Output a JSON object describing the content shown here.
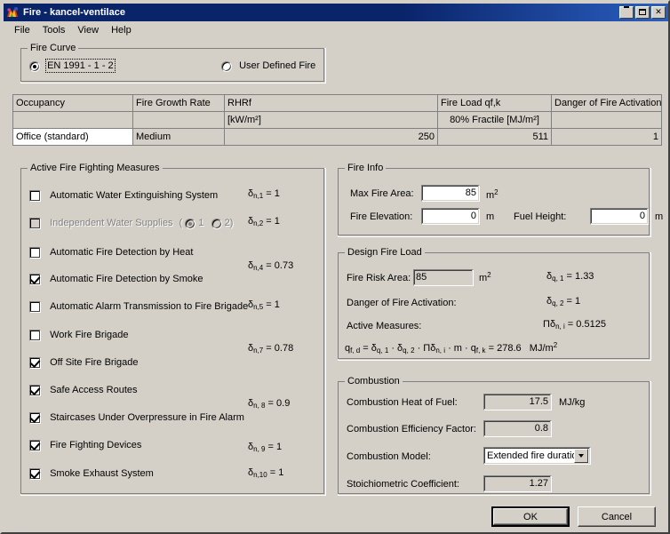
{
  "window": {
    "title": "Fire - kancel-ventilace",
    "icon": "flame-icon",
    "minimize": "–",
    "maximize": "□",
    "close": "✕"
  },
  "menu": [
    {
      "label": "File"
    },
    {
      "label": "Tools"
    },
    {
      "label": "View"
    },
    {
      "label": "Help"
    }
  ],
  "fire_curve": {
    "title": "Fire Curve",
    "options": [
      {
        "label": "EN 1991 - 1 - 2",
        "selected": true
      },
      {
        "label": "User Defined Fire",
        "selected": false
      }
    ]
  },
  "table": {
    "headers": [
      "Occupancy",
      "Fire Growth Rate",
      "RHRf",
      "Fire Load qf,k",
      "Danger of Fire Activation"
    ],
    "units": [
      "",
      "",
      "[kW/m²]",
      "80% Fractile [MJ/m²]",
      ""
    ],
    "row": [
      "Office (standard)",
      "Medium",
      "250",
      "511",
      "1"
    ]
  },
  "measures": {
    "title": "Active Fire Fighting Measures",
    "items": [
      {
        "label": "Automatic Water Extinguishing System",
        "checked": false,
        "disabled": false
      },
      {
        "label": "Independent Water Supplies",
        "checked": false,
        "disabled": true,
        "radios": [
          {
            "label": "1",
            "selected": true
          },
          {
            "label": "2",
            "selected": false
          }
        ]
      },
      {
        "label": "Automatic Fire Detection by Heat",
        "checked": false,
        "disabled": false
      },
      {
        "label": "Automatic Fire Detection by Smoke",
        "checked": true,
        "disabled": false
      },
      {
        "label": "Automatic Alarm Transmission to Fire Brigade",
        "checked": false,
        "disabled": false
      },
      {
        "label": "Work Fire Brigade",
        "checked": false,
        "disabled": false
      },
      {
        "label": "Off Site Fire Brigade",
        "checked": true,
        "disabled": false
      },
      {
        "label": "Safe Access Routes",
        "checked": true,
        "disabled": false
      },
      {
        "label": "Staircases Under Overpressure in Fire Alarm",
        "checked": true,
        "disabled": false
      },
      {
        "label": "Fire Fighting Devices",
        "checked": true,
        "disabled": false
      },
      {
        "label": "Smoke Exhaust System",
        "checked": true,
        "disabled": false
      }
    ],
    "deltas": [
      {
        "index": "n,1",
        "value": "1"
      },
      {
        "index": "n,2",
        "value": "1"
      },
      {
        "index": "n,4",
        "value": "0.73"
      },
      {
        "index": "n,5",
        "value": "1"
      },
      {
        "index": "n,7",
        "value": "0.78"
      },
      {
        "index": "n, 8",
        "value": "0.9"
      },
      {
        "index": "n, 9",
        "value": "1"
      },
      {
        "index": "n,10",
        "value": "1"
      }
    ]
  },
  "fire_info": {
    "title": "Fire Info",
    "max_fire_area": {
      "label": "Max Fire Area:",
      "value": "85",
      "unit": "m",
      "unit_sup": "2"
    },
    "fire_elevation": {
      "label": "Fire Elevation:",
      "value": "0",
      "unit": "m"
    },
    "fuel_height": {
      "label": "Fuel Height:",
      "value": "0",
      "unit": "m"
    }
  },
  "design_fire_load": {
    "title": "Design Fire Load",
    "fire_risk_area": {
      "label": "Fire Risk Area:",
      "value": "85",
      "unit": "m",
      "unit_sup": "2"
    },
    "danger_label": "Danger of Fire Activation:",
    "active_measures_label": "Active Measures:",
    "delta_q1": {
      "index": "q, 1",
      "value": "1.33"
    },
    "delta_q2": {
      "index": "q, 2",
      "value": "1"
    },
    "prod_delta_n": {
      "index": "n, i",
      "value": "0.5125"
    },
    "formula_result": "278.6",
    "formula_unit": "MJ/m",
    "formula_unit_sup": "2"
  },
  "combustion": {
    "title": "Combustion",
    "heat_of_fuel": {
      "label": "Combustion Heat of Fuel:",
      "value": "17.5",
      "unit": "MJ/kg"
    },
    "efficiency": {
      "label": "Combustion Efficiency Factor:",
      "value": "0.8"
    },
    "model": {
      "label": "Combustion Model:",
      "value": "Extended fire duratio"
    },
    "stoichiometric": {
      "label": "Stoichiometric Coefficient:",
      "value": "1.27"
    }
  },
  "buttons": {
    "ok": "OK",
    "cancel": "Cancel"
  }
}
